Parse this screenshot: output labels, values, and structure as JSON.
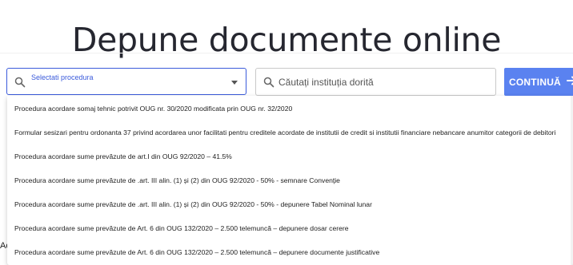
{
  "header": {
    "title": "Depune documente online"
  },
  "procedure_select": {
    "label": "Selectati procedura"
  },
  "institution_search": {
    "placeholder": "Căutați instituția dorită"
  },
  "continue_button": {
    "label": "CONTINUĂ"
  },
  "background": {
    "fragment": "Ac"
  },
  "dropdown": {
    "options": [
      "Procedura acordare somaj tehnic potrivit OUG nr. 30/2020 modificata prin OUG nr. 32/2020",
      "Formular sesizari pentru ordonanta 37 privind acordarea unor facilitati pentru creditele acordate de institutii de credit si institutii financiare nebancare anumitor categorii de debitori",
      "Procedura acordare sume prevăzute de art.I din OUG 92/2020 – 41.5%",
      "Procedura acordare sume prevăzute de .art. III alin. (1) și (2) din OUG 92/2020 - 50% - semnare Convenție",
      "Procedura acordare sume prevăzute de .art. III alin. (1) și (2) din OUG 92/2020 - 50% - depunere Tabel Nominal lunar",
      "Procedura acordare sume prevăzute de Art. 6 din OUG 132/2020 – 2.500 telemuncă – depunere dosar cerere",
      "Procedura acordare sume prevăzute de Art. 6 din OUG 132/2020 – 2.500 telemuncă – depunere documente justificative"
    ]
  },
  "colors": {
    "accent": "#3b5bdb",
    "button": "#5a82f0"
  },
  "icons": [
    "search-icon",
    "caret-down-icon",
    "arrow-right-icon"
  ]
}
